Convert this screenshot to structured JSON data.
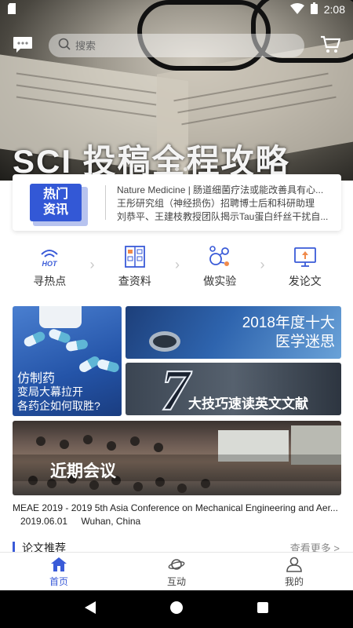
{
  "status_bar": {
    "time": "2:08"
  },
  "hero": {
    "title": "SCI 投稿全程攻略"
  },
  "search": {
    "placeholder": "搜索"
  },
  "news": {
    "badge": [
      "热门",
      "资讯"
    ],
    "items": [
      "Nature Medicine | 肠道细菌疗法或能改善具有心...",
      "王彤研究组（神经损伤）招聘博士后和科研助理",
      "刘恭平、王建枝教授团队揭示Tau蛋白纤丝干扰自..."
    ]
  },
  "quick_nav": [
    {
      "label": "寻热点",
      "icon": "hot-wifi-icon"
    },
    {
      "label": "查资料",
      "icon": "archive-cabinet-icon"
    },
    {
      "label": "做实验",
      "icon": "molecule-icon"
    },
    {
      "label": "发论文",
      "icon": "monitor-upload-icon"
    }
  ],
  "tiles": {
    "drug": {
      "title": "仿制药",
      "subtitle": "变局大幕拉开\n各药企如何取胜?"
    },
    "myth": {
      "line1": "2018年度十大",
      "line2": "医学迷思"
    },
    "read": {
      "number": "7",
      "text": "大技巧速读英文文献"
    },
    "conference": {
      "text": "近期会议"
    }
  },
  "conference": {
    "title": "MEAE 2019 - 2019 5th Asia Conference on Mechanical Engineering and Aer...",
    "date": "2019.06.01",
    "location": "Wuhan, China"
  },
  "section": {
    "title": "论文推荐",
    "more": "查看更多 >"
  },
  "tabs": [
    {
      "label": "首页",
      "icon": "home-icon",
      "active": true
    },
    {
      "label": "互动",
      "icon": "planet-icon",
      "active": false
    },
    {
      "label": "我的",
      "icon": "user-icon",
      "active": false
    }
  ],
  "colors": {
    "accent": "#3a5bd8",
    "badge": "#3358d6"
  }
}
